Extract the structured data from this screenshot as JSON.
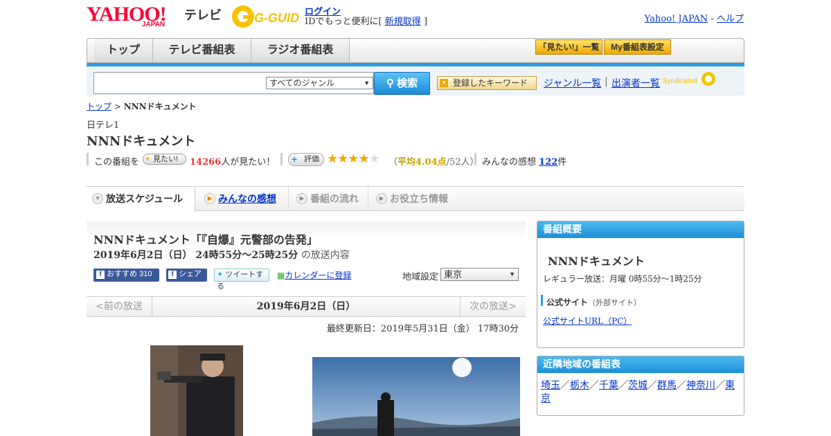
{
  "header": {
    "logo": "YAHOO!",
    "logo_sub": "JAPAN",
    "tv": "テレビ",
    "gguide": "G-GUIDE",
    "login": "ログイン",
    "id_prefix": "IDでもっと便利に[",
    "register": "新規取得",
    "id_suffix": "]",
    "yahoo_japan": "Yahoo! JAPAN",
    "sep": "-",
    "help": "ヘルプ"
  },
  "nav": {
    "tabs": [
      "トップ",
      "テレビ番組表",
      "ラジオ番組表"
    ],
    "mitai_list": "「見たい!」一覧",
    "my_schedule": "My番組表設定"
  },
  "search": {
    "genre": "すべてのジャンル",
    "button": "検索",
    "keyword_button": "登録したキーワード",
    "genre_list": "ジャンル一覧",
    "divider": "|",
    "performers": "出演者一覧",
    "syndicated": "Syndicated"
  },
  "breadcrumb": {
    "top": "トップ",
    "sep": ">",
    "current": "NNNドキュメント"
  },
  "program": {
    "channel": "日テレ1",
    "title": "NNNドキュメント",
    "mitai_prefix": "この番組を",
    "mitai_button": "見たい!",
    "mitai_count": "14266",
    "mitai_suffix": "人が見たい！",
    "rate_button": "評価",
    "rating": 4.04,
    "rating_open": "（",
    "rating_avg": "平均4.04点",
    "rating_count": "/52人）",
    "impressions_label": "みんなの感想",
    "impressions_count": "122",
    "impressions_suffix": "件"
  },
  "subtabs": [
    "放送スケジュール",
    "みんなの感想",
    "番組の流れ",
    "お役立ち情報"
  ],
  "episode": {
    "title": "NNNドキュメント「『自爆』元警部の告発」",
    "datetime": "2019年6月2日（日） 24時55分～25時25分",
    "suffix": "の放送内容",
    "fb_recommend": "おすすめ",
    "fb_count": "310",
    "fb_share": "シェア",
    "tweet": "ツイートする",
    "calendar": "カレンダーに登録",
    "region_label": "地域設定",
    "region": "東京",
    "prev": "<前の放送",
    "date": "2019年6月2日（日）",
    "next": "次の放送>",
    "updated": "最終更新日：2019年5月31日（金） 17時30分"
  },
  "overview": {
    "heading": "番組概要",
    "title": "NNNドキュメント",
    "regular": "レギュラー放送：月曜 0時55分～1時25分",
    "official_label": "公式サイト",
    "official_note": "（外部サイト）",
    "official_link": "公式サイトURL（PC）"
  },
  "nearby": {
    "heading": "近隣地域の番組表",
    "regions": [
      "埼玉",
      "栃木",
      "千葉",
      "茨城",
      "群馬",
      "神奈川",
      "東京"
    ],
    "sep": "／"
  }
}
